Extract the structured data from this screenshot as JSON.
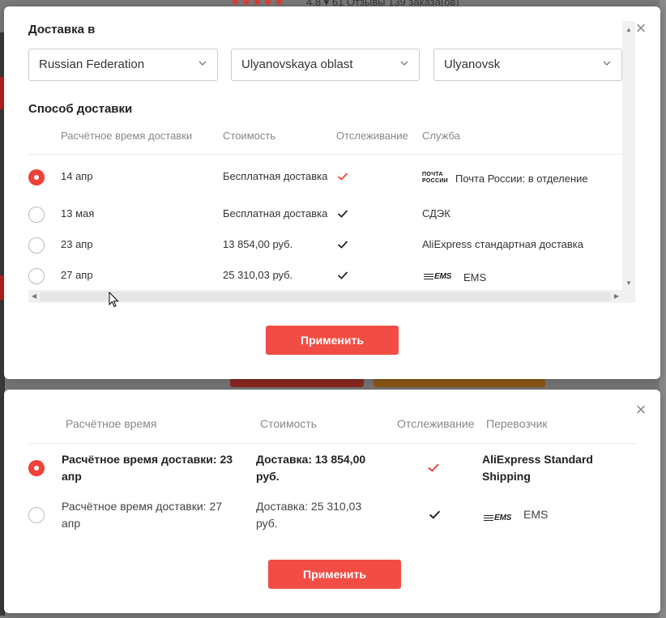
{
  "background": {
    "rating_text": "4.8 ▾   61 Отзывы   139 заказа(ов)",
    "stars": "★★★★★"
  },
  "modal1": {
    "title": "Доставка в",
    "close_icon": "×",
    "selects": [
      {
        "value": "Russian Federation"
      },
      {
        "value": "Ulyanovskaya oblast"
      },
      {
        "value": "Ulyanovsk"
      }
    ],
    "subtitle": "Способ доставки",
    "headers": {
      "time": "Расчётное время доставки",
      "cost": "Стоимость",
      "tracking": "Отслеживание",
      "service": "Служба"
    },
    "rows": [
      {
        "selected": true,
        "date": "14 апр",
        "cost": "Бесплатная доставка",
        "tracking": true,
        "logo": "ПОЧТА\nРОССИИ",
        "service": "Почта России: в отделение"
      },
      {
        "selected": false,
        "date": "13 мая",
        "cost": "Бесплатная доставка",
        "tracking": true,
        "logo": "",
        "service": "СДЭК"
      },
      {
        "selected": false,
        "date": "23 апр",
        "cost": "13 854,00 руб.",
        "tracking": true,
        "logo": "",
        "service": "AliExpress стандартная доставка"
      },
      {
        "selected": false,
        "date": "27 апр",
        "cost": "25 310,03 руб.",
        "tracking": true,
        "logo": "EMS",
        "service": "EMS"
      }
    ],
    "apply_label": "Применить",
    "colors": {
      "accent": "#f24d45",
      "check_selected": "#f0413a"
    }
  },
  "modal2": {
    "close_icon": "×",
    "headers": {
      "time": "Расчётное время",
      "cost": "Стоимость",
      "tracking": "Отслеживание",
      "carrier": "Перевозчик"
    },
    "rows": [
      {
        "selected": true,
        "time": "Расчётное время доставки: 23 апр",
        "cost": "Доставка: 13 854,00 руб.",
        "tracking": true,
        "carrier": "AliExpress Standard Shipping"
      },
      {
        "selected": false,
        "time": "Расчётное время доставки: 27 апр",
        "cost": "Доставка: 25 310,03 руб.",
        "tracking": true,
        "carrier_logo": "EMS",
        "carrier": "EMS"
      }
    ],
    "apply_label": "Применить"
  }
}
